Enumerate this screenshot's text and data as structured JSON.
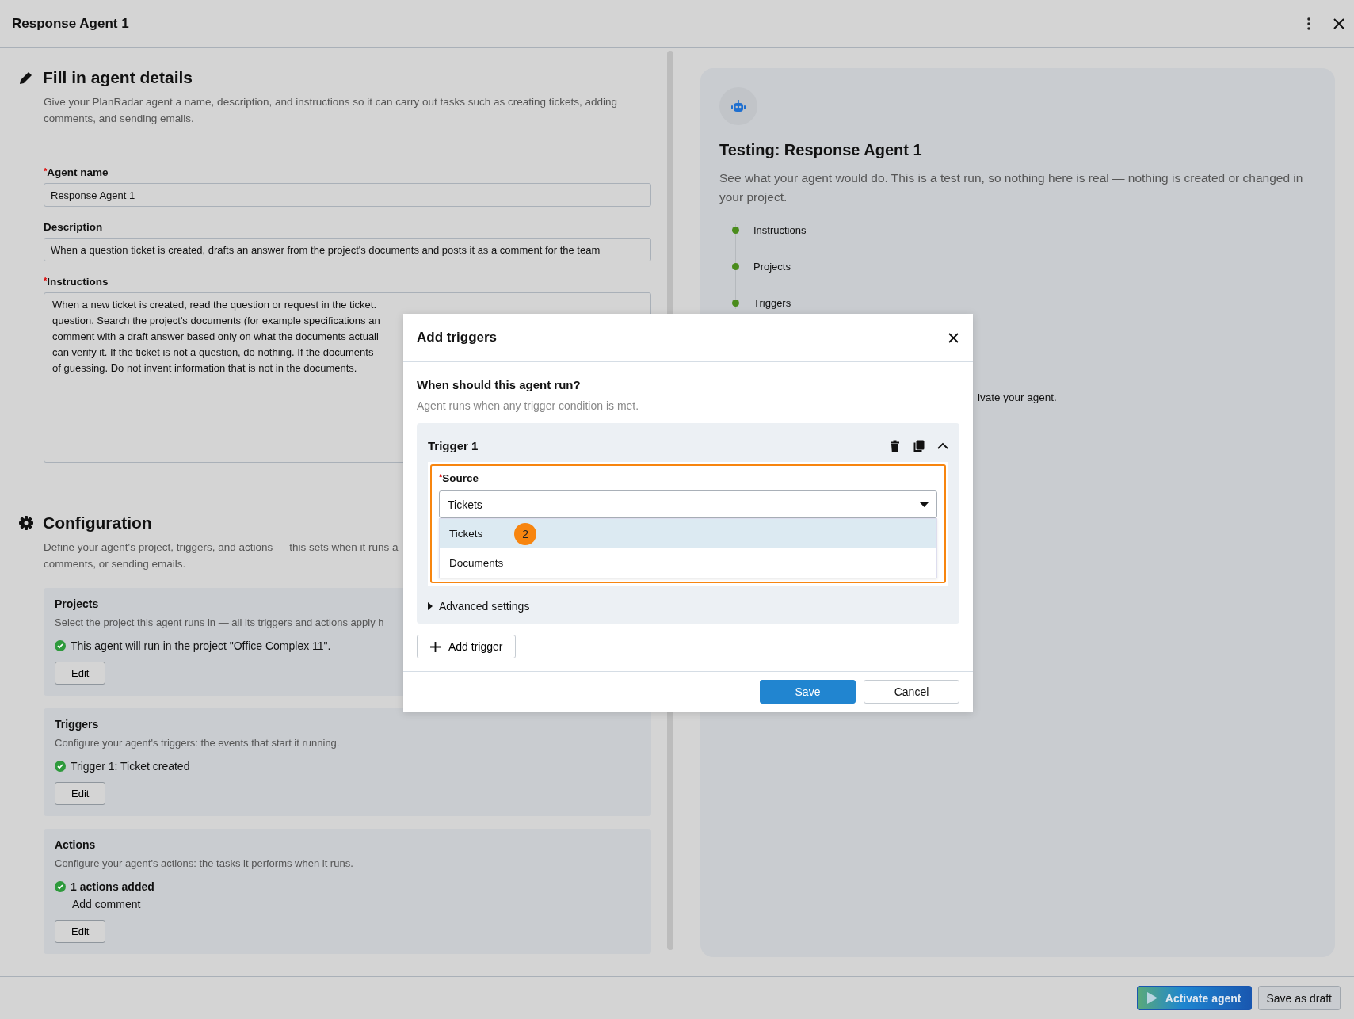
{
  "window": {
    "title": "Response Agent 1"
  },
  "details": {
    "title": "Fill in agent details",
    "description": "Give your PlanRadar agent a name, description, and instructions so it can carry out tasks such as creating tickets, adding comments, and sending emails.",
    "fields": [
      {
        "kind": "input",
        "label": "Agent name",
        "required_mark": "*",
        "value": "Response Agent 1"
      },
      {
        "kind": "input",
        "label": "Description",
        "value": "When a question ticket is created, drafts an answer from the project's documents and posts it as a comment for the team"
      },
      {
        "kind": "textarea",
        "label": "Instructions",
        "required_mark": "*",
        "lines": [
          "When a new ticket is created, read the question or request in the ticket.",
          "question. Search the project's documents (for example specifications an",
          "comment with a draft answer based only on what the documents actuall",
          "can verify it. If the ticket is not a question, do nothing. If the documents",
          "of guessing. Do not invent information that is not in the documents."
        ]
      }
    ]
  },
  "configuration": {
    "title": "Configuration",
    "description_lines": [
      "Define your agent's project, triggers, and actions — this sets when it runs a",
      "comments, or sending emails."
    ],
    "cards": [
      {
        "title": "Projects",
        "description": "Select the project this agent runs in — all its triggers and actions apply h",
        "status": "This agent will run in the project \"Office Complex 11\".",
        "status_bold": false,
        "button": "Edit"
      },
      {
        "title": "Triggers",
        "description": "Configure your agent's triggers: the events that start it running.",
        "status": "Trigger 1: Ticket created",
        "status_bold": false,
        "button": "Edit"
      },
      {
        "title": "Actions",
        "description": "Configure your agent's actions: the tasks it performs when it runs.",
        "status": "1 actions added",
        "status_bold": true,
        "detail": "Add comment",
        "button": "Edit"
      }
    ]
  },
  "testing": {
    "title": "Testing: Response Agent 1",
    "description": "See what your agent would do. This is a test run, so nothing here is real — nothing is created or changed in your project.",
    "steps": [
      {
        "label": "Instructions",
        "done": true
      },
      {
        "label": "Projects",
        "done": true
      },
      {
        "label": "Triggers",
        "done": true
      }
    ],
    "note": "ivate your agent."
  },
  "dialog": {
    "title": "Add triggers",
    "heading": "When should this agent run?",
    "hint": "Agent runs when any trigger condition is met.",
    "triggers": [
      {
        "title": "Trigger 1",
        "expanded": true,
        "source": {
          "label": "Source",
          "required_mark": "*",
          "value": "Tickets",
          "open": true,
          "callout": "2",
          "options": [
            {
              "label": "Tickets",
              "selected": true
            },
            {
              "label": "Documents",
              "selected": false
            }
          ]
        },
        "advanced": {
          "label": "Advanced settings",
          "expanded": false
        }
      }
    ],
    "add_button": "Add trigger",
    "buttons": [
      {
        "label": "Save",
        "kind": "primary"
      },
      {
        "label": "Cancel",
        "kind": "secondary"
      }
    ]
  },
  "footer": {
    "buttons": [
      {
        "label": "Activate agent",
        "kind": "primary"
      },
      {
        "label": "Save as draft",
        "kind": "secondary"
      }
    ]
  }
}
